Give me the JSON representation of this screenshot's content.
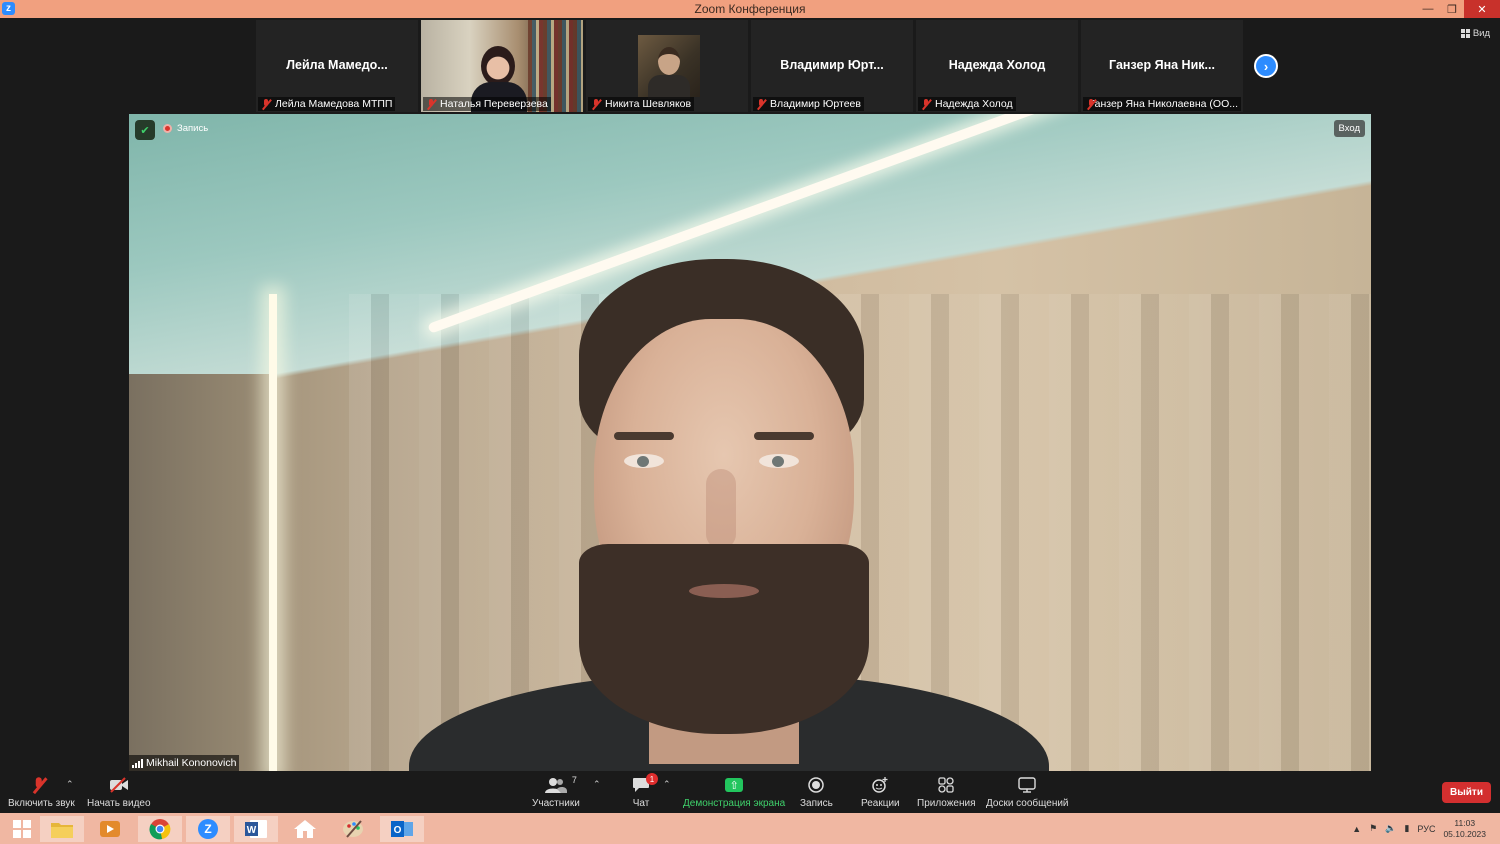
{
  "window": {
    "title": "Zoom Конференция"
  },
  "strip": {
    "tiles": [
      {
        "big_name": "Лейла  Мамедо...",
        "label": "Лейла Мамедова МТПП"
      },
      {
        "big_name": "",
        "label": "Наталья Переверзева"
      },
      {
        "big_name": "",
        "label": "Никита Шевляков"
      },
      {
        "big_name": "Владимир  Юрт...",
        "label": "Владимир Юртеев"
      },
      {
        "big_name": "Надежда Холод",
        "label": "Надежда Холод"
      },
      {
        "big_name": "Ганзер  Яна  Ник...",
        "label": "Ганзер Яна Николаевна (ОО..."
      }
    ],
    "view_label": "Вид"
  },
  "main_video": {
    "recording_label": "Запись",
    "enter_label": "Вход",
    "speaker_name": "Mikhail Kononovich"
  },
  "toolbar": {
    "unmute": "Включить звук",
    "start_video": "Начать видео",
    "participants": "Участники",
    "participants_count": "7",
    "chat": "Чат",
    "chat_badge": "1",
    "share_screen": "Демонстрация экрана",
    "record": "Запись",
    "reactions": "Реакции",
    "apps": "Приложения",
    "whiteboards": "Доски сообщений",
    "leave": "Выйти"
  },
  "taskbar": {
    "lang": "РУС",
    "time": "11:03",
    "date": "05.10.2023"
  },
  "colors": {
    "title_bar": "#f1a07f",
    "taskbar": "#f0b7a2",
    "accent": "#2d8cff",
    "leave": "#d32f2f",
    "share_green": "#22c55e"
  }
}
